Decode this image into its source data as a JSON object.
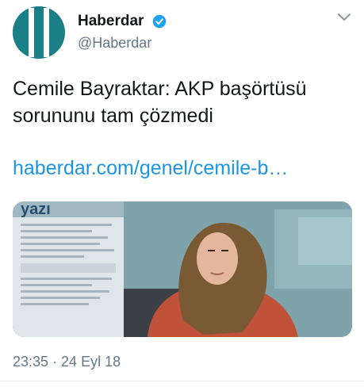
{
  "account": {
    "display_name": "Haberdar",
    "handle": "@Haberdar",
    "verified": true,
    "avatar_icon": "haberdar-logo-icon",
    "brand_color": "#1a7f86"
  },
  "tweet": {
    "text": "Cemile Bayraktar: AKP başörtüsü sorununu tam çözmedi",
    "link": "haberdar.com/genel/cemile-b…",
    "link_color": "#1b95e0",
    "timestamp": "23:35 · 24 Eyl 18"
  },
  "media": {
    "newspaper_masthead": "yazı"
  },
  "icons": {
    "verified": "verified-badge-icon",
    "more": "chevron-down-icon"
  }
}
